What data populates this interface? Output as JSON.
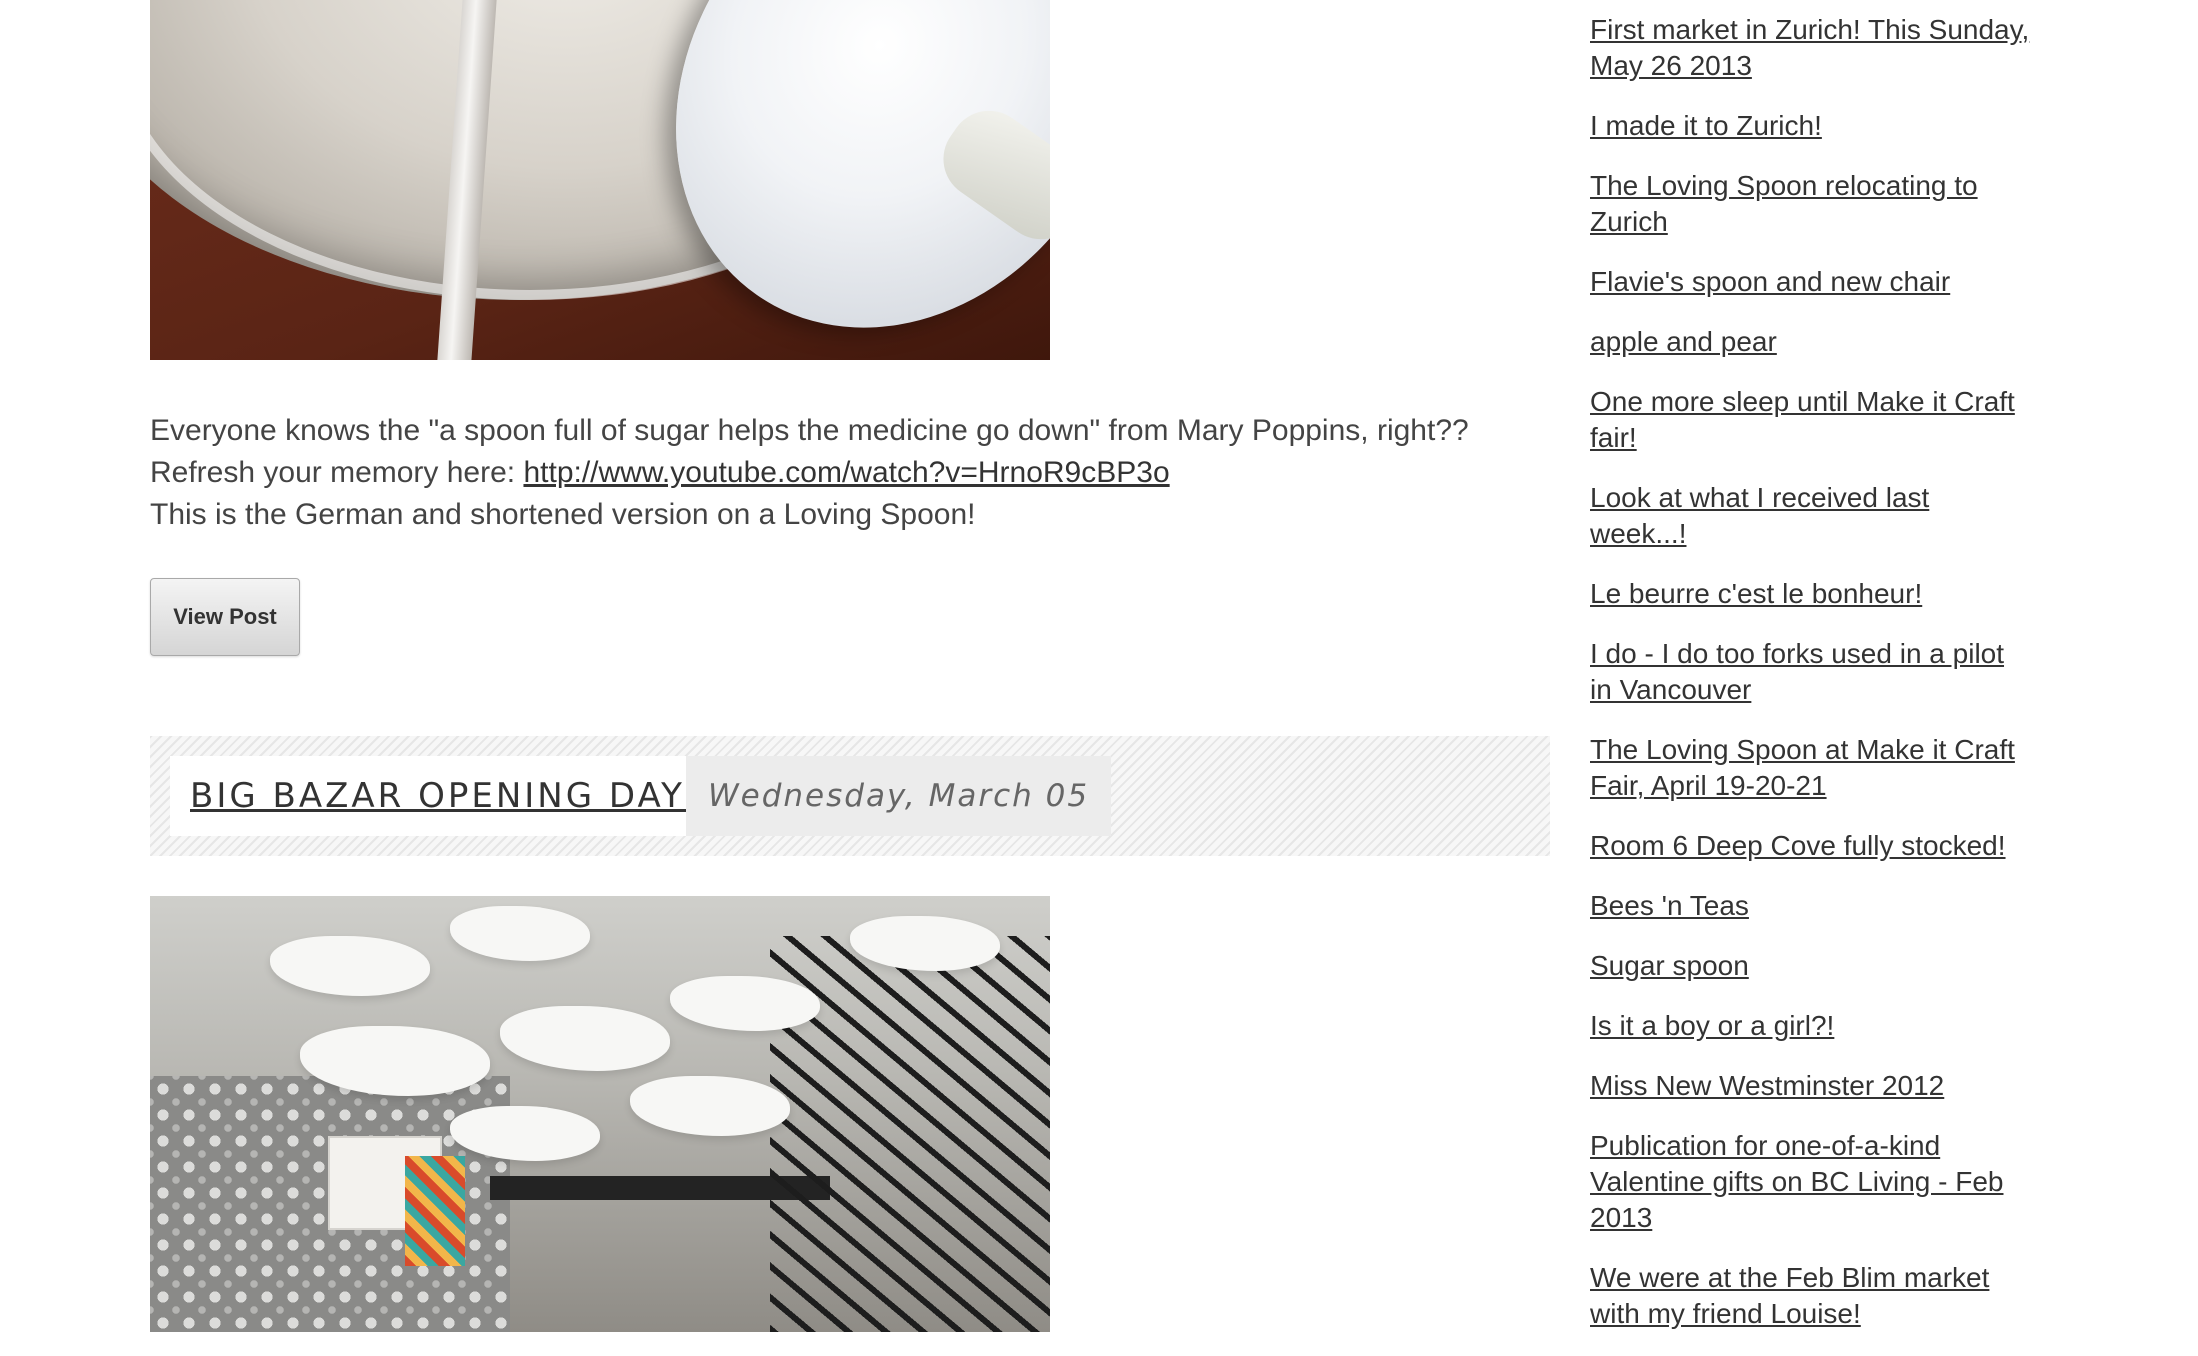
{
  "post_excerpt": {
    "line1": "Everyone knows the \"a spoon full of sugar helps the medicine go down\" from Mary Poppins, right??",
    "line2_prefix": "Refresh your memory here: ",
    "line2_link": "http://www.youtube.com/watch?v=HrnoR9cBP3o",
    "line3": "This is the German and shortened version on a Loving Spoon!"
  },
  "view_post_button": "View Post",
  "next_post": {
    "title": "BIG BAZAR OPENING DAY!",
    "date": "Wednesday, March 05"
  },
  "sidebar": {
    "items": [
      "First market in Zurich! This Sunday, May 26 2013",
      "I made it to Zurich!",
      "The Loving Spoon relocating to Zurich",
      "Flavie's spoon and new chair",
      "apple and pear",
      "One more sleep until Make it Craft fair!",
      "Look at what I received last week...!",
      "Le beurre c'est le bonheur!",
      "I do - I do too forks used in a pilot in Vancouver",
      "The Loving Spoon at Make it Craft Fair, April 19-20-21",
      "Room 6 Deep Cove fully stocked!",
      "Bees 'n Teas",
      "Sugar spoon",
      "Is it a boy or a girl?!",
      "Miss New Westminster 2012",
      "Publication for one-of-a-kind Valentine gifts on BC Living - Feb 2013",
      "We were at the Feb Blim market with my friend Louise!"
    ]
  }
}
